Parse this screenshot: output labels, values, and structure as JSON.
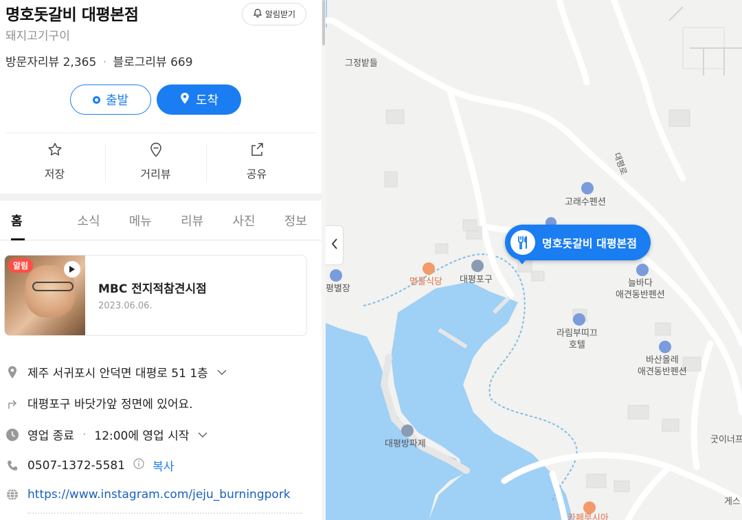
{
  "place": {
    "title": "명호돗갈비 대평본점",
    "category": "돼지고기구이",
    "visitor_reviews_label": "방문자리뷰",
    "visitor_reviews_count": "2,365",
    "blog_reviews_label": "블로그리뷰",
    "blog_reviews_count": "669",
    "alarm_label": "알림받기"
  },
  "route": {
    "depart_label": "출발",
    "arrive_label": "도착"
  },
  "actions": {
    "save_label": "저장",
    "street_label": "거리뷰",
    "share_label": "공유"
  },
  "tabs": [
    "홈",
    "소식",
    "메뉴",
    "리뷰",
    "사진",
    "정보"
  ],
  "news": {
    "badge": "알림",
    "title": "MBC 전지적참견시점",
    "date": "2023.06.06."
  },
  "info": {
    "address": "제주 서귀포시 안덕면 대평로 51 1층",
    "directions": "대평포구 바닷가앞 정면에 있어요.",
    "status": "영업 종료",
    "hours": "12:00에 영업 시작",
    "phone": "0507-1372-5581",
    "copy_label": "복사",
    "website": "https://www.instagram.com/jeju_burningpork"
  },
  "map": {
    "marker_label": "명호돗갈비 대평본점",
    "labels": {
      "field": "그정밭들",
      "road": "대평로",
      "goraesu": "고래수펜션",
      "myungmul": "명물식당",
      "daepyeong_port": "대평포구",
      "neulbada": "늘바다\n애견동반펜션",
      "larim": "라림부띠끄\n호텔",
      "basan": "바산올레\n애견동반펜션",
      "byeoljang": "평별장",
      "breakwater": "대평방파제",
      "guesthouse_cut": "굿이너프",
      "cafe_cut": "카페루시아",
      "east_cut": "게스"
    }
  },
  "colors": {
    "accent": "#1a7df2",
    "sea": "#9fd0f6",
    "land": "#f2f2f0"
  }
}
